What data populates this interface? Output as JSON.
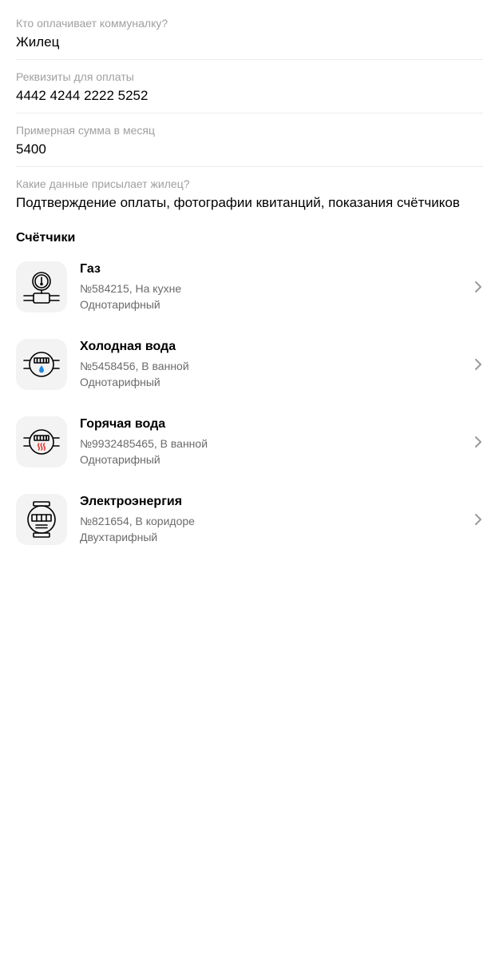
{
  "fields": [
    {
      "label": "Кто оплачивает коммуналку?",
      "value": "Жилец"
    },
    {
      "label": "Реквизиты для оплаты",
      "value": "4442 4244 2222 5252"
    },
    {
      "label": "Примерная сумма в месяц",
      "value": "5400"
    },
    {
      "label": "Какие данные присылает жилец?",
      "value": "Подтверждение оплаты, фотографии квитанций, показания счётчиков"
    }
  ],
  "meters_section": {
    "title": "Счётчики",
    "items": [
      {
        "title": "Газ",
        "line1": "№584215, На кухне",
        "line2": "Однотарифный",
        "icon": "gas-meter-icon"
      },
      {
        "title": "Холодная вода",
        "line1": "№5458456, В ванной",
        "line2": "Однотарифный",
        "icon": "cold-water-meter-icon"
      },
      {
        "title": "Горячая вода",
        "line1": "№9932485465, В ванной",
        "line2": "Однотарифный",
        "icon": "hot-water-meter-icon"
      },
      {
        "title": "Электроэнергия",
        "line1": "№821654, В коридоре",
        "line2": "Двухтарифный",
        "icon": "electricity-meter-icon"
      }
    ]
  },
  "colors": {
    "label": "#a0a0a0",
    "secondary": "#6b6b6b",
    "icon_bg": "#f3f3f3",
    "cold_water": "#1e88e5",
    "hot_water": "#e53935"
  }
}
